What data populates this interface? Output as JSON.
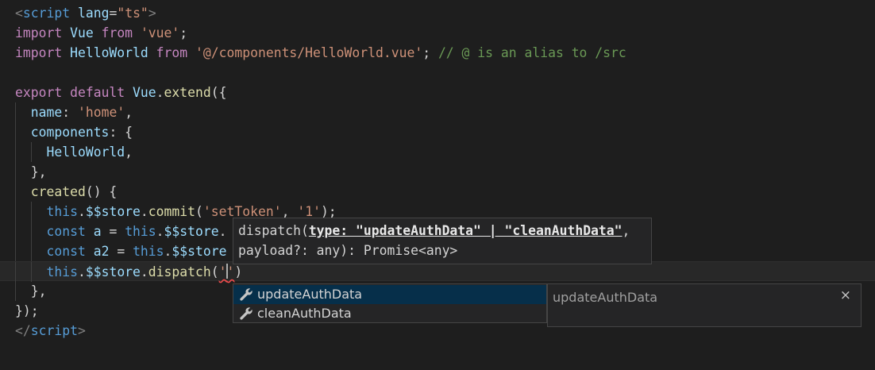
{
  "editor": {
    "lines": [
      [
        {
          "c": "tag",
          "t": "<"
        },
        {
          "c": "tagname",
          "t": "script"
        },
        {
          "c": "punc",
          "t": " "
        },
        {
          "c": "attr",
          "t": "lang"
        },
        {
          "c": "punc",
          "t": "="
        },
        {
          "c": "str",
          "t": "\"ts\""
        },
        {
          "c": "tag",
          "t": ">"
        }
      ],
      [
        {
          "c": "kw",
          "t": "import"
        },
        {
          "c": "punc",
          "t": " "
        },
        {
          "c": "var",
          "t": "Vue"
        },
        {
          "c": "punc",
          "t": " "
        },
        {
          "c": "kw",
          "t": "from"
        },
        {
          "c": "punc",
          "t": " "
        },
        {
          "c": "str",
          "t": "'vue'"
        },
        {
          "c": "punc",
          "t": ";"
        }
      ],
      [
        {
          "c": "kw",
          "t": "import"
        },
        {
          "c": "punc",
          "t": " "
        },
        {
          "c": "var",
          "t": "HelloWorld"
        },
        {
          "c": "punc",
          "t": " "
        },
        {
          "c": "kw",
          "t": "from"
        },
        {
          "c": "punc",
          "t": " "
        },
        {
          "c": "str",
          "t": "'@/components/HelloWorld.vue'"
        },
        {
          "c": "punc",
          "t": "; "
        },
        {
          "c": "comment",
          "t": "// @ is an alias to /src"
        }
      ],
      [],
      [
        {
          "c": "kw",
          "t": "export"
        },
        {
          "c": "punc",
          "t": " "
        },
        {
          "c": "kw",
          "t": "default"
        },
        {
          "c": "punc",
          "t": " "
        },
        {
          "c": "var",
          "t": "Vue"
        },
        {
          "c": "punc",
          "t": "."
        },
        {
          "c": "fn",
          "t": "extend"
        },
        {
          "c": "punc",
          "t": "({"
        }
      ],
      [
        {
          "c": "punc",
          "t": "  "
        },
        {
          "c": "var",
          "t": "name"
        },
        {
          "c": "punc",
          "t": ": "
        },
        {
          "c": "str",
          "t": "'home'"
        },
        {
          "c": "punc",
          "t": ","
        }
      ],
      [
        {
          "c": "punc",
          "t": "  "
        },
        {
          "c": "var",
          "t": "components"
        },
        {
          "c": "punc",
          "t": ": {"
        }
      ],
      [
        {
          "c": "punc",
          "t": "    "
        },
        {
          "c": "var",
          "t": "HelloWorld"
        },
        {
          "c": "punc",
          "t": ","
        }
      ],
      [
        {
          "c": "punc",
          "t": "  },"
        }
      ],
      [
        {
          "c": "punc",
          "t": "  "
        },
        {
          "c": "fn",
          "t": "created"
        },
        {
          "c": "punc",
          "t": "() {"
        }
      ],
      [
        {
          "c": "punc",
          "t": "    "
        },
        {
          "c": "kwb",
          "t": "this"
        },
        {
          "c": "punc",
          "t": "."
        },
        {
          "c": "var",
          "t": "$$store"
        },
        {
          "c": "punc",
          "t": "."
        },
        {
          "c": "fn",
          "t": "commit"
        },
        {
          "c": "punc",
          "t": "("
        },
        {
          "c": "str",
          "t": "'setToken'"
        },
        {
          "c": "punc",
          "t": ", "
        },
        {
          "c": "str",
          "t": "'1'"
        },
        {
          "c": "punc",
          "t": ");"
        }
      ],
      [
        {
          "c": "punc",
          "t": "    "
        },
        {
          "c": "kwb",
          "t": "const"
        },
        {
          "c": "punc",
          "t": " "
        },
        {
          "c": "var",
          "t": "a"
        },
        {
          "c": "punc",
          "t": " = "
        },
        {
          "c": "kwb",
          "t": "this"
        },
        {
          "c": "punc",
          "t": "."
        },
        {
          "c": "var",
          "t": "$$store"
        },
        {
          "c": "punc",
          "t": "."
        }
      ],
      [
        {
          "c": "punc",
          "t": "    "
        },
        {
          "c": "kwb",
          "t": "const"
        },
        {
          "c": "punc",
          "t": " "
        },
        {
          "c": "var",
          "t": "a2"
        },
        {
          "c": "punc",
          "t": " = "
        },
        {
          "c": "kwb",
          "t": "this"
        },
        {
          "c": "punc",
          "t": "."
        },
        {
          "c": "var",
          "t": "$$store"
        }
      ],
      [
        {
          "c": "punc",
          "t": "    "
        },
        {
          "c": "kwb",
          "t": "this"
        },
        {
          "c": "punc",
          "t": "."
        },
        {
          "c": "var",
          "t": "$$store"
        },
        {
          "c": "punc",
          "t": "."
        },
        {
          "c": "fn",
          "t": "dispatch"
        },
        {
          "c": "punc",
          "t": "("
        },
        {
          "c": "str squiggle",
          "t": "'"
        },
        {
          "c": "cursor",
          "t": ""
        },
        {
          "c": "str squiggle",
          "t": "'"
        },
        {
          "c": "punc",
          "t": ")"
        }
      ],
      [
        {
          "c": "punc",
          "t": "  },"
        }
      ],
      [
        {
          "c": "punc",
          "t": "});"
        }
      ],
      [
        {
          "c": "tag",
          "t": "</"
        },
        {
          "c": "tagname",
          "t": "script"
        },
        {
          "c": "tag",
          "t": ">"
        }
      ]
    ],
    "guides": [
      [],
      [],
      [],
      [],
      [],
      [
        0
      ],
      [
        0
      ],
      [
        0,
        1
      ],
      [
        0
      ],
      [
        0
      ],
      [
        0,
        1
      ],
      [
        0,
        1
      ],
      [
        0,
        1
      ],
      [
        0,
        1
      ],
      [
        0
      ],
      [],
      []
    ],
    "current_line": 13
  },
  "hover": {
    "sig_prefix": "dispatch(",
    "sig_active_param": "type: \"updateAuthData\" | \"cleanAuthData\"",
    "sig_suffix": ",",
    "sig_line2": "payload?: any): Promise<any>"
  },
  "suggest": {
    "items": [
      {
        "label": "updateAuthData",
        "icon": "wrench-icon",
        "selected": true
      },
      {
        "label": "cleanAuthData",
        "icon": "wrench-icon",
        "selected": false
      }
    ]
  },
  "details": {
    "title": "updateAuthData",
    "close": "×"
  },
  "colors": {
    "background": "#1e1e1e",
    "keyword": "#c586c0",
    "string": "#ce9178",
    "variable": "#9cdcfe",
    "function": "#dcdcaa",
    "comment": "#6a9955",
    "selection": "#062f4a"
  }
}
